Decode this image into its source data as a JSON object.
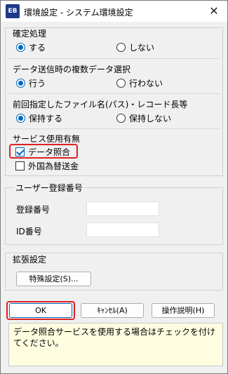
{
  "window": {
    "icon_text": "EB",
    "title": "環境設定 - システム環境設定",
    "close_glyph": "✕"
  },
  "confirm_section": {
    "label": "確定処理",
    "options": [
      "する",
      "しない"
    ],
    "selected": "する"
  },
  "multi_data_section": {
    "label": "データ送信時の複数データ選択",
    "options": [
      "行う",
      "行わない"
    ],
    "selected": "行う"
  },
  "filename_section": {
    "label": "前回指定したファイル名(パス)・レコード長等",
    "options": [
      "保持する",
      "保持しない"
    ],
    "selected": "保持する"
  },
  "services_section": {
    "label": "サービス使用有無",
    "items": [
      {
        "label": "データ照合",
        "checked": true
      },
      {
        "label": "外国為替送金",
        "checked": false
      }
    ]
  },
  "registration_group": {
    "title": "ユーザー登録番号",
    "fields": [
      {
        "label": "登録番号",
        "value": ""
      },
      {
        "label": "ID番号",
        "value": ""
      }
    ]
  },
  "extension_section": {
    "label": "拡張設定",
    "special_settings_button": "特殊設定(S)..."
  },
  "footer_buttons": {
    "ok": "OK",
    "cancel": "ｷｬﾝｾﾙ(A)",
    "help": "操作説明(H)"
  },
  "help_text": "データ照合サービスを使用する場合はチェックを付けてください。",
  "colors": {
    "accent": "#0067c0",
    "highlight": "#e02020",
    "help_background": "#fffde0"
  }
}
